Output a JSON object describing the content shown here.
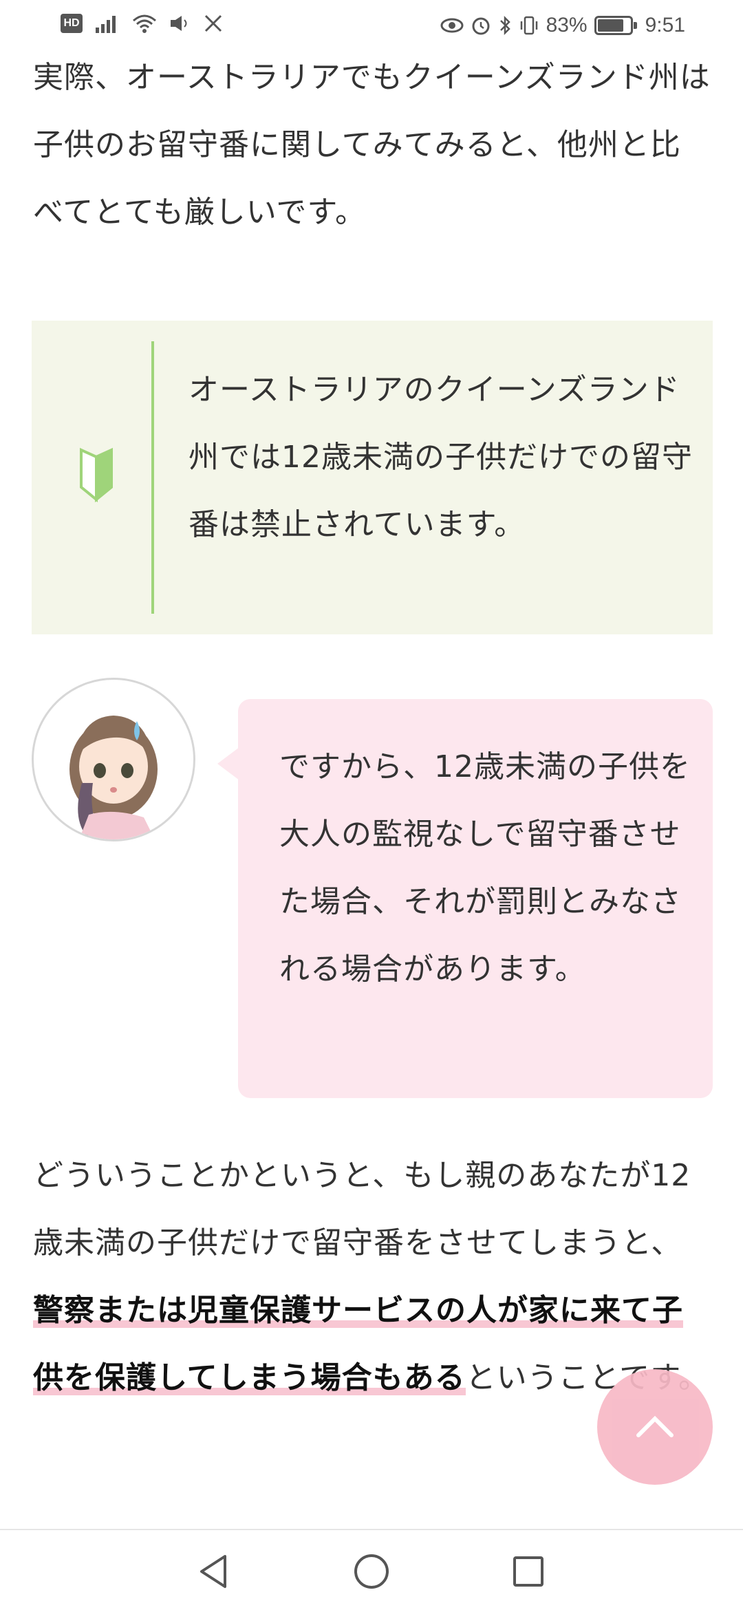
{
  "status_bar": {
    "left_icons": [
      "hd-icon",
      "signal-icon",
      "wifi-icon",
      "speaker-icon",
      "x-icon"
    ],
    "hd_label": "HD",
    "right_icons": [
      "eye-icon",
      "alarm-icon",
      "bluetooth-icon",
      "vibrate-icon",
      "battery-icon"
    ],
    "battery_percent": "83%",
    "battery_level": 0.83,
    "time": "9:51"
  },
  "article": {
    "paragraph1": "実際、オーストラリアでもクイーンズランド州は子供のお留守番に関してみてみると、他州と比べてとても厳しいです。",
    "tip_box": {
      "icon": "beginner-mark-icon",
      "text": "オーストラリアのクイーンズランド州では12歳未満の子供だけでの留守番は禁止されています。"
    },
    "speech": {
      "avatar": "girl-avatar",
      "text": "ですから、12歳未満の子供を大人の監視なしで留守番させた場合、それが罰則とみなされる場合があります。"
    },
    "paragraph3_before": "どういうことかというと、もし親のあなたが12歳未満の子供だけで留守番をさせてしまうと、",
    "paragraph3_highlight": "警察または児童保護サービスの人が家に来て子供を保護してしまう場合もある",
    "paragraph3_after": "ということです。"
  },
  "scroll_top": {
    "icon": "chevron-up-icon"
  },
  "nav_bar": {
    "icons": [
      "back-triangle-icon",
      "home-circle-icon",
      "recents-square-icon"
    ]
  },
  "colors": {
    "tip_bg": "#f4f6e9",
    "tip_rule": "#9fd47a",
    "bubble_bg": "#fde7ee",
    "highlight_underline": "#f8c7d3",
    "scroll_button": "#f7b8c6"
  }
}
